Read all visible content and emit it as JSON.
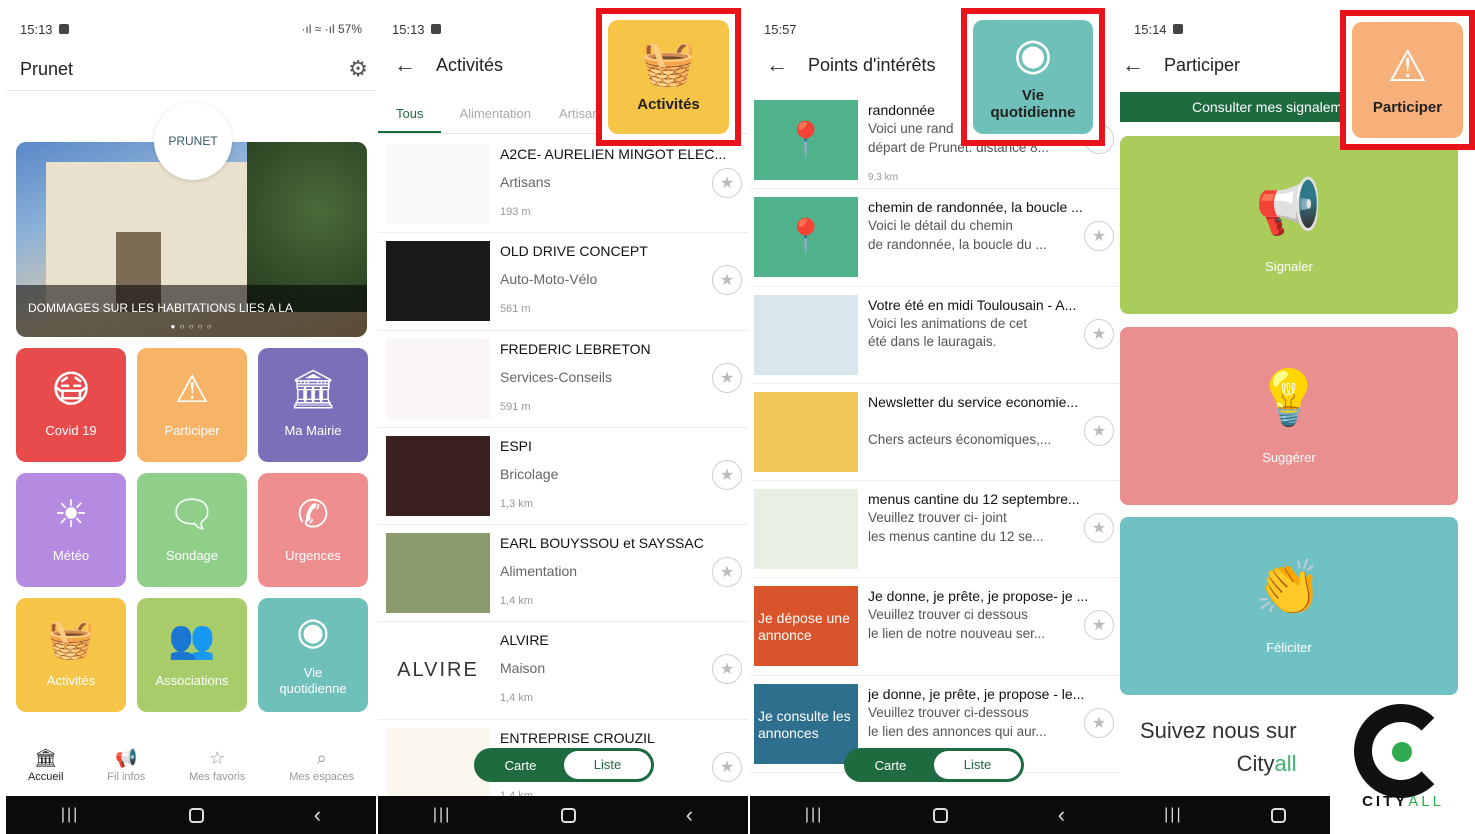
{
  "colors": {
    "covid": "#e84b4b",
    "participer": "#f7b366",
    "mairie": "#7a6fb8",
    "meteo": "#b48be0",
    "sondage": "#8fcf8a",
    "urgences": "#ef8e8e",
    "activites": "#f6c447",
    "associations": "#a9cc6a",
    "vie": "#6fc0b8",
    "signaler": "#a9cc5a",
    "suggerer": "#ea8f8f",
    "feliciter": "#6fc1c3",
    "brand_green": "#1e6b40",
    "highlight_red": "#e8131b"
  },
  "s1": {
    "status": {
      "time": "15:13",
      "right": "·ıl ≈ ·ıl 57%"
    },
    "title": "Prunet",
    "brand": "PRUNET",
    "hero_caption": "DOMMAGES SUR LES HABITATIONS LIES A LA",
    "tiles": [
      {
        "label": "Covid 19",
        "icon": "mask-icon"
      },
      {
        "label": "Participer",
        "icon": "warning-icon"
      },
      {
        "label": "Ma Mairie",
        "icon": "townhall-icon"
      },
      {
        "label": "Météo",
        "icon": "sun-icon"
      },
      {
        "label": "Sondage",
        "icon": "survey-icon"
      },
      {
        "label": "Urgences",
        "icon": "phone-icon"
      },
      {
        "label": "Activités",
        "icon": "basket-icon"
      },
      {
        "label": "Associations",
        "icon": "people-icon"
      },
      {
        "label": "Vie quotidienne",
        "icon": "pin-icon"
      }
    ],
    "tabs": [
      {
        "label": "Accueil",
        "icon": "home-icon"
      },
      {
        "label": "Fil infos",
        "icon": "megaphone-icon"
      },
      {
        "label": "Mes favoris",
        "icon": "star-icon"
      },
      {
        "label": "Mes espaces",
        "icon": "search-icon"
      }
    ]
  },
  "s2": {
    "status": {
      "time": "15:13"
    },
    "title": "Activités",
    "tabs": [
      "Tous",
      "Alimentation",
      "Artisans"
    ],
    "items": [
      {
        "name": "A2CE- AURELIEN MINGOT ELEC...",
        "category": "Artisans",
        "distance": "193 m"
      },
      {
        "name": "OLD DRIVE CONCEPT",
        "category": "Auto-Moto-Vélo",
        "distance": "561 m"
      },
      {
        "name": "FREDERIC LEBRETON",
        "category": "Services-Conseils",
        "distance": "591 m"
      },
      {
        "name": "ESPI",
        "category": "Bricolage",
        "distance": "1,3 km"
      },
      {
        "name": "EARL BOUYSSOU  et SAYSSAC",
        "category": "Alimentation",
        "distance": "1,4 km"
      },
      {
        "name": "ALVIRE",
        "category": "Maison",
        "distance": "1,4 km"
      },
      {
        "name": "ENTREPRISE CROUZIL",
        "category": "",
        "distance": "1,4 km"
      }
    ],
    "toggle": {
      "carte": "Carte",
      "liste": "Liste"
    },
    "callout": "Activités"
  },
  "s3": {
    "status": {
      "time": "15:57"
    },
    "title": "Points d'intérêts",
    "items": [
      {
        "name": "randonnée",
        "desc1": "Voici une rand",
        "desc2": "départ de Prunet. distance 8...",
        "distance": "9,3 km"
      },
      {
        "name": "chemin de randonnée, la boucle ...",
        "desc1": "Voici le détail du chemin",
        "desc2": "de randonnée, la boucle du ...",
        "distance": ""
      },
      {
        "name": "Votre été en midi Toulousain - A...",
        "desc1": "Voici les animations de cet",
        "desc2": "été dans le lauragais.",
        "distance": ""
      },
      {
        "name": "Newsletter du service economie...",
        "desc1": "",
        "desc2": "Chers acteurs économiques,...",
        "distance": ""
      },
      {
        "name": "menus cantine du 12 septembre...",
        "desc1": "Veuillez trouver ci- joint",
        "desc2": "les menus cantine du 12 se...",
        "distance": ""
      },
      {
        "name": "Je donne, je prête, je propose- je ...",
        "desc1": "Veuillez trouver ci dessous",
        "desc2": "le lien de notre nouveau ser...",
        "distance": "",
        "thumb": "Je dépose une annonce"
      },
      {
        "name": "je donne, je prête, je propose - le...",
        "desc1": "Veuillez trouver ci-dessous",
        "desc2": "le lien des annonces qui aur...",
        "distance": "",
        "thumb": "Je consulte les annonces"
      }
    ],
    "toggle": {
      "carte": "Carte",
      "liste": "Liste"
    },
    "callout": "Vie quotidienne"
  },
  "s4": {
    "status": {
      "time": "15:14"
    },
    "title": "Participer",
    "banner": "Consulter mes signalements",
    "tiles": [
      {
        "label": "Signaler",
        "icon": "megaphone-icon"
      },
      {
        "label": "Suggérer",
        "icon": "lightbulb-icon"
      },
      {
        "label": "Féliciter",
        "icon": "clap-icon"
      }
    ],
    "follow_line1": "Suivez nous sur",
    "follow_city": "City",
    "follow_all": "all",
    "logo_city": "CITY",
    "logo_all": "ALL",
    "callout": "Participer"
  }
}
